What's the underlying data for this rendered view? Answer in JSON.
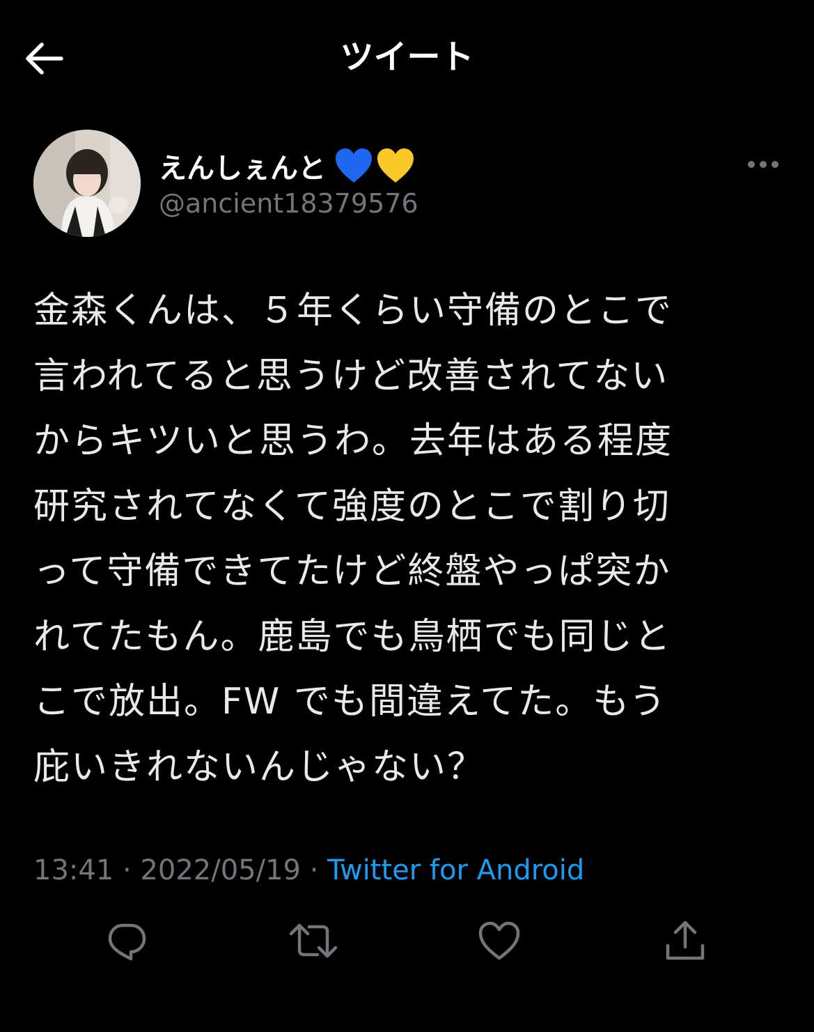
{
  "header": {
    "title": "ツイート",
    "back_icon": "arrow-left-icon"
  },
  "author": {
    "display_name": "えんしぇんと",
    "emoji": "💙💛",
    "handle": "@ancient18379576",
    "more_icon": "more-horizontal-icon"
  },
  "tweet": {
    "text": "金森くんは、５年くらい守備のとこで\n言われてると思うけど改善されてない\nからキツいと思うわ。去年はある程度\n研究されてなくて強度のとこで割り切\nって守備できてたけど終盤やっぱ突か\nれてたもん。鹿島でも鳥栖でも同じと\nこで放出。FW でも間違えてた。もう\n庇いきれないんじゃない？"
  },
  "meta": {
    "time": "13:41",
    "separator": " · ",
    "date": "2022/05/19",
    "source": "Twitter for Android"
  },
  "actions": {
    "reply_icon": "reply-icon",
    "retweet_icon": "retweet-icon",
    "like_icon": "heart-icon",
    "share_icon": "share-icon"
  },
  "colors": {
    "background": "#000000",
    "text": "#e7e9ea",
    "secondary": "#71767b",
    "link": "#1d9bf0"
  }
}
